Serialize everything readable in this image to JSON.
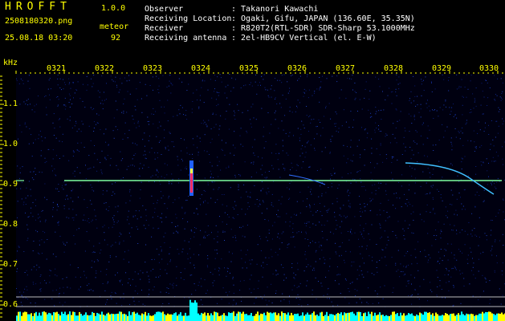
{
  "header": {
    "app_name": "HROFFT",
    "version": "1.0.0",
    "file_name": "2508180320.png",
    "datetime": "25.08.18 03:20",
    "event_label": "meteor",
    "event_count": "92",
    "info_keys": [
      "Observer",
      "Receiving Location",
      "Receiver",
      "Receiving antenna"
    ],
    "info_values": [
      ": Takanori Kawachi",
      ": Ogaki, Gifu, JAPAN (136.60E, 35.35N)",
      ": R820T2(RTL-SDR) SDR-Sharp 53.1000MHz",
      ": 2el-HB9CV Vertical (el. E-W)"
    ]
  },
  "axes": {
    "unit": "kHz",
    "time_ticks": [
      "0321",
      "0322",
      "0323",
      "0324",
      "0325",
      "0326",
      "0327",
      "0328",
      "0329",
      "0330"
    ],
    "freq_ticks": [
      "1.1",
      "1.0",
      "0.9",
      "0.8",
      "0.7",
      "0.6"
    ]
  },
  "colors": {
    "label_yellow": "#ffff00",
    "label_white": "#ffffff",
    "carrier": "#7fffa0",
    "meteor_head": "#ff3060",
    "noise_blue": "#1030a0",
    "spectrum_cyan": "#00ffff",
    "spectrum_yellow": "#ffff00"
  }
}
